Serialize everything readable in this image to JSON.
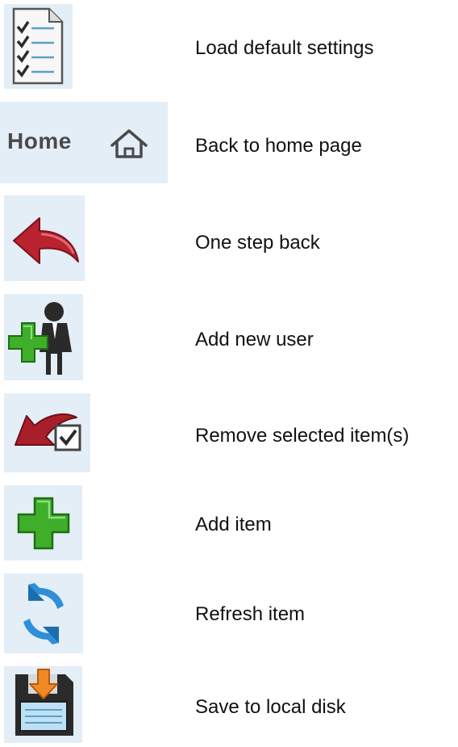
{
  "legend": {
    "items": [
      {
        "icon": "default-settings-icon",
        "label": "Load default settings"
      },
      {
        "icon": "home-icon",
        "label": "Back to home page",
        "icon_text": "Home"
      },
      {
        "icon": "back-arrow-icon",
        "label": "One step back"
      },
      {
        "icon": "add-user-icon",
        "label": "Add new user"
      },
      {
        "icon": "remove-item-icon",
        "label": "Remove selected item(s)"
      },
      {
        "icon": "add-item-icon",
        "label": "Add item"
      },
      {
        "icon": "refresh-icon",
        "label": "Refresh item"
      },
      {
        "icon": "save-disk-icon",
        "label": "Save to local disk"
      }
    ]
  },
  "colors": {
    "icon_background": "#e3eef7",
    "text": "#111111",
    "home_text": "#4a4a4a",
    "back_arrow": "#b8232f",
    "green_plus": "#3fae2a",
    "refresh_blue": "#2f8fd8",
    "save_orange": "#f08a24"
  }
}
